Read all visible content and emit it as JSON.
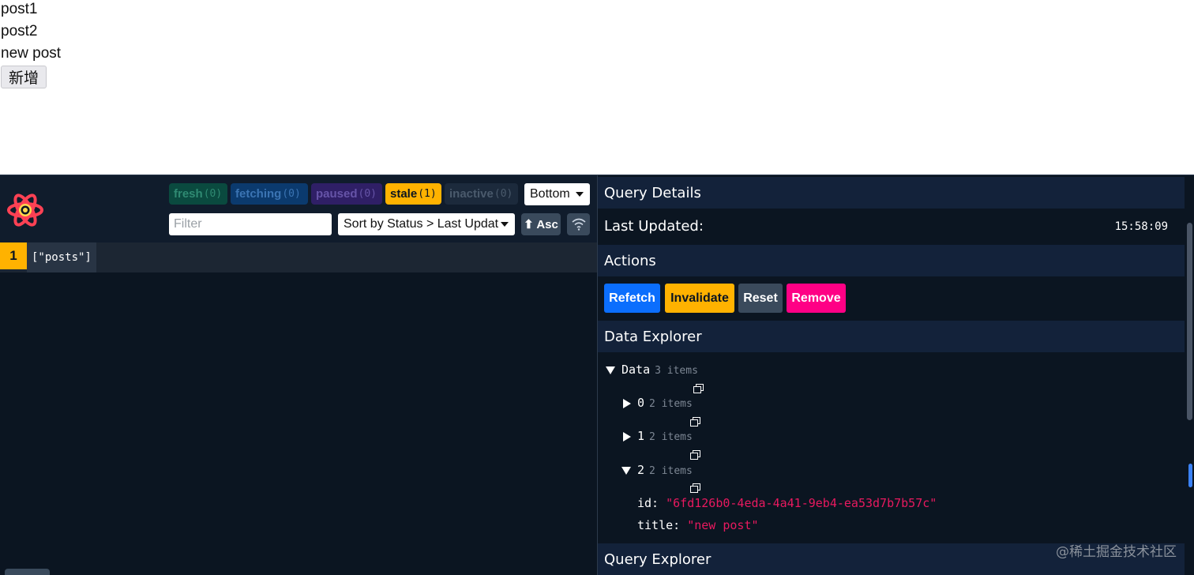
{
  "page": {
    "posts": [
      "post1",
      "post2",
      "new post"
    ],
    "add_button": "新增"
  },
  "devtools": {
    "badges": {
      "fresh": {
        "label": "fresh",
        "count": "(0)"
      },
      "fetching": {
        "label": "fetching",
        "count": "(0)"
      },
      "paused": {
        "label": "paused",
        "count": "(0)"
      },
      "stale": {
        "label": "stale",
        "count": "(1)"
      },
      "inactive": {
        "label": "inactive",
        "count": "(0)"
      }
    },
    "position_select": "Bottom",
    "filter_placeholder": "Filter",
    "sort_select": "Sort by Status > Last Updated",
    "asc_button": "⬆ Asc",
    "query": {
      "count": "1",
      "key": "[\"posts\"]"
    },
    "details": {
      "query_details_title": "Query Details",
      "last_updated_label": "Last Updated:",
      "last_updated_value": "15:58:09",
      "actions_title": "Actions",
      "actions": {
        "refetch": "Refetch",
        "invalidate": "Invalidate",
        "reset": "Reset",
        "remove": "Remove"
      },
      "data_explorer_title": "Data Explorer",
      "tree": {
        "root": {
          "label": "Data",
          "meta": "3 items"
        },
        "item0": {
          "label": "0",
          "meta": "2 items"
        },
        "item1": {
          "label": "1",
          "meta": "2 items"
        },
        "item2": {
          "label": "2",
          "meta": "2 items"
        },
        "id_key": "id:",
        "id_value": "\"6fd126b0-4eda-4a41-9eb4-ea53d7b7b57c\"",
        "title_key": "title:",
        "title_value": "\"new post\""
      },
      "query_explorer_title": "Query Explorer"
    },
    "colors": {
      "stale": "#ffb200",
      "refetch": "#0b6efd",
      "remove": "#ff0085",
      "string_value": "#e8195f",
      "panel_bg": "#0b1521"
    }
  },
  "watermark": "@稀土掘金技术社区"
}
